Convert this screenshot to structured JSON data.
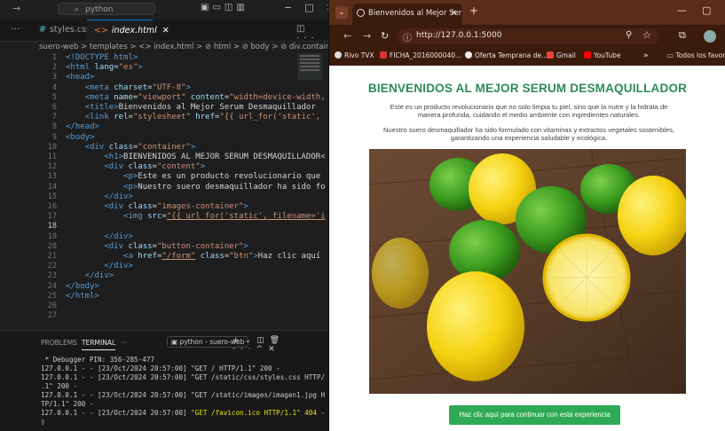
{
  "vscode": {
    "search_text": "python",
    "tabs": [
      {
        "label": "styles.css"
      },
      {
        "label": "index.html",
        "close": "✕"
      }
    ],
    "breadcrumb": "suero-web > templates > <> index.html > ⊘ html > ⊘ body > ⊘ div.container > ⊘ div.im",
    "line_numbers": [
      "1",
      "2",
      "3",
      "4",
      "5",
      "6",
      "7",
      "8",
      "9",
      "10",
      "11",
      "12",
      "13",
      "14",
      "15",
      "16",
      "17",
      "18",
      "19",
      "20",
      "21",
      "22",
      "23",
      "24",
      "25",
      "26",
      "27"
    ],
    "code": {
      "l1": "<!DOCTYPE html>",
      "l2a": "<html ",
      "l2b": "lang",
      "l2c": "=",
      "l2d": "\"es\"",
      "l2e": ">",
      "l3": "<head>",
      "l4a": "    <meta ",
      "l4b": "charset",
      "l4c": "=",
      "l4d": "\"UTF-8\"",
      "l4e": ">",
      "l5a": "    <meta ",
      "l5b": "name",
      "l5c": "=",
      "l5d": "\"viewport\"",
      "l5e": " content",
      "l5f": "=",
      "l5g": "\"width=device-width,",
      "l6a": "    <title>",
      "l6b": "Bienvenidos al Mejor Serum Desmaquillador",
      "l7a": "    <link ",
      "l7b": "rel",
      "l7c": "=",
      "l7d": "\"stylesheet\"",
      "l7e": " href",
      "l7f": "=",
      "l7g": "\"{{ url_for('static',",
      "l8": "</head>",
      "l9": "<body>",
      "l10a": "    <div ",
      "l10b": "class",
      "l10c": "=",
      "l10d": "\"container\"",
      "l10e": ">",
      "l11a": "        <h1>",
      "l11b": "BIENVENIDOS AL MEJOR SERUM DESMAQUILLADOR<",
      "l12a": "        <div ",
      "l12b": "class",
      "l12c": "=",
      "l12d": "\"content\"",
      "l12e": ">",
      "l13a": "            <p>",
      "l13b": "Este es un producto revolucionario que",
      "l14a": "            <p>",
      "l14b": "Nuestro suero desmaquillador ha sido fo",
      "l15": "        </div>",
      "l16a": "        <div ",
      "l16b": "class",
      "l16c": "=",
      "l16d": "\"images-container\"",
      "l16e": ">",
      "l17a": "            <img ",
      "l17b": "src",
      "l17c": "=",
      "l17d": "\"{{ url_for('static', filename='i",
      "l19": "        </div>",
      "l20a": "        <div ",
      "l20b": "class",
      "l20c": "=",
      "l20d": "\"button-container\"",
      "l20e": ">",
      "l21a": "            <a ",
      "l21b": "href",
      "l21c": "=",
      "l21d": "\"/form\"",
      "l21e": " class",
      "l21f": "=",
      "l21g": "\"btn\"",
      "l21h": ">",
      "l21i": "Haz clic aquí",
      "l22": "        </div>",
      "l23": "    </div>",
      "l24": "</body>",
      "l25": "</html>"
    },
    "panel": {
      "problems": "PROBLEMS",
      "terminal": "TERMINAL",
      "more": "···",
      "terminal_name": "python - suero-web",
      "output": [
        " * Debugger PIN: 356-285-477",
        "127.0.0.1 - - [23/Oct/2024 20:57:00] \"GET / HTTP/1.1\" 200 -",
        "127.0.0.1 - - [23/Oct/2024 20:57:00] \"GET /static/css/styles.css HTTP/1",
        ".1\" 200 -",
        "127.0.0.1 - - [23/Oct/2024 20:57:00] \"GET /static/images/imagen1.jpg HT",
        "TP/1.1\" 200 -"
      ],
      "last_prefix": "127.0.0.1 - - [23/Oct/2024 20:57:00] ",
      "last_highlight": "\"GET /favicon.ico HTTP/1.1\" 404",
      "last_suffix": " -"
    }
  },
  "browser": {
    "tab_title": "Bienvenidos al Mejor Serum De",
    "tab_close": "✕",
    "url": "http://127.0.0.1:5000",
    "bookmarks": [
      "Rivo TVX",
      "FICHA_2016000040...",
      "Oferta Temprana de...",
      "Gmail",
      "YouTube"
    ],
    "bookmarks_overflow": "»",
    "all_bookmarks": "Todos los favoritos",
    "page": {
      "title": "BIENVENIDOS AL MEJOR SERUM DESMAQUILLADOR",
      "p1": "Este es un producto revolucionario que no solo limpia tu piel, sino que la nutre y la hidrata de manera profunda, cuidando el medio ambiente con ingredientes naturales.",
      "p2": "Nuestro suero desmaquillador ha sido formulado con vitaminas y extractos vegetales sostenibles, garantizando una experiencia saludable y ecológica.",
      "cta": "Haz clic aquí para continuar con esta experiencia"
    }
  },
  "colors": {
    "title_green": "#2e8b57",
    "button_green": "#2eaa55",
    "browser_frame": "#3a1b0c"
  }
}
